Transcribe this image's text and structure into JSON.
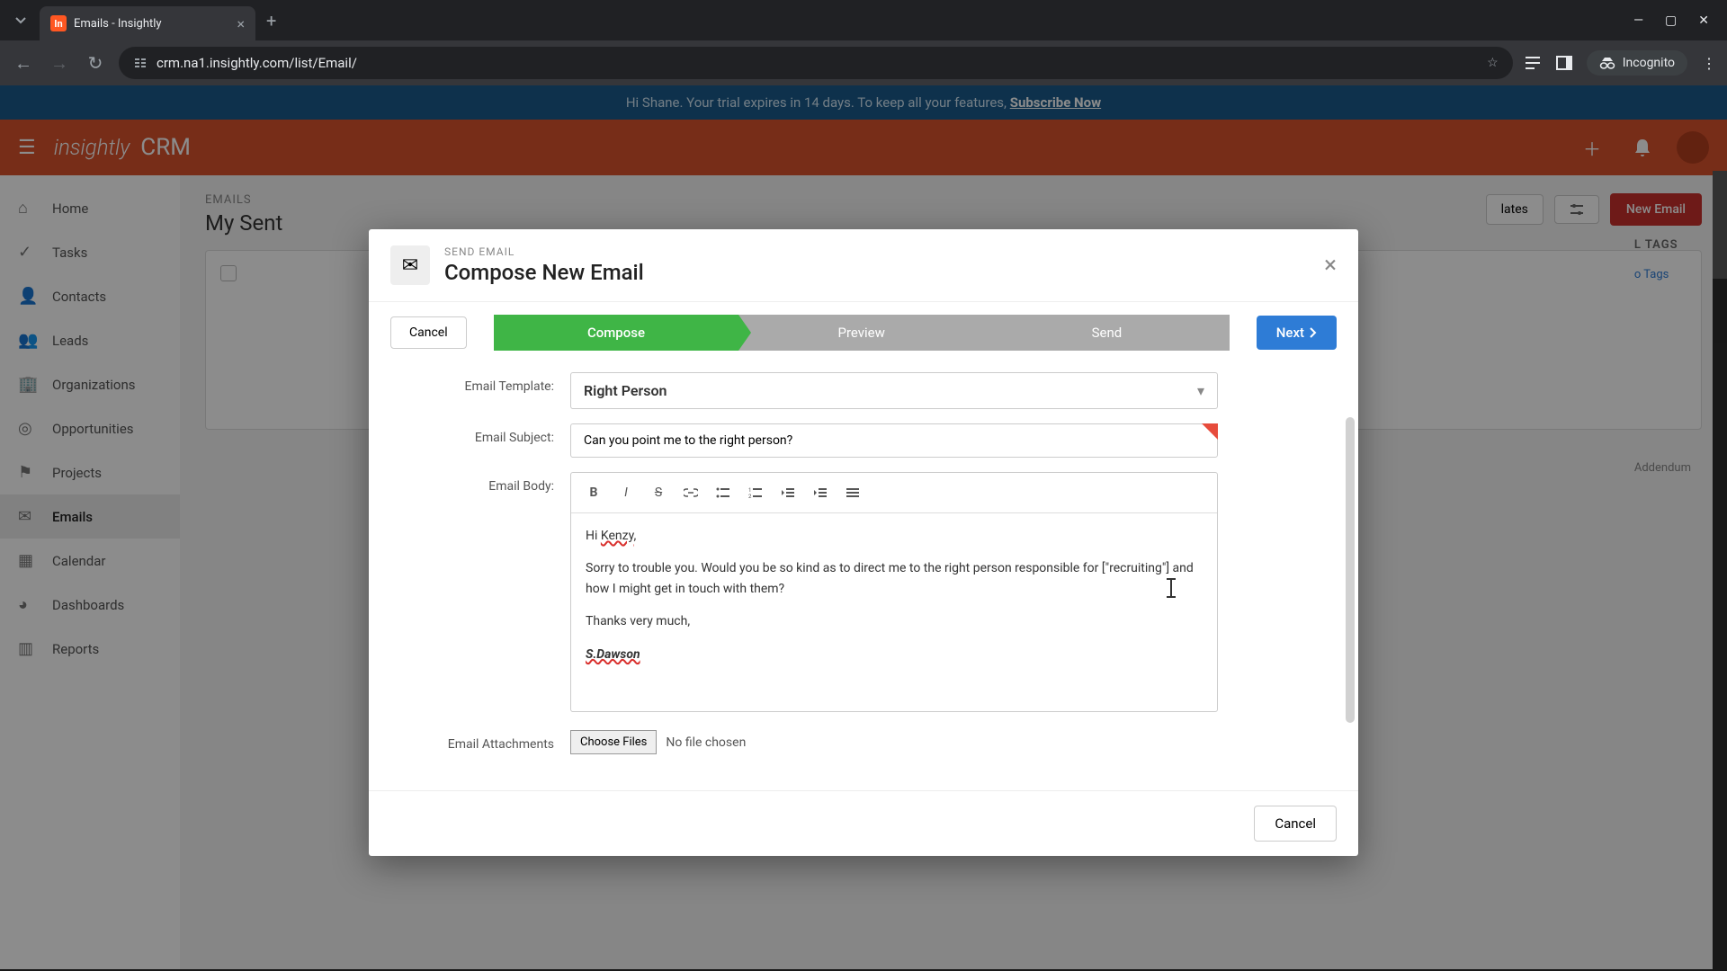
{
  "browser": {
    "tab_title": "Emails - Insightly",
    "url": "crm.na1.insightly.com/list/Email/",
    "incognito": "Incognito"
  },
  "banner": {
    "greeting": "Hi Shane. Your trial expires in 14 days. To keep all your features, ",
    "cta": "Subscribe Now"
  },
  "header": {
    "logo": "insightly",
    "product": "CRM"
  },
  "sidebar": {
    "items": [
      {
        "label": "Home"
      },
      {
        "label": "Tasks"
      },
      {
        "label": "Contacts"
      },
      {
        "label": "Leads"
      },
      {
        "label": "Organizations"
      },
      {
        "label": "Opportunities"
      },
      {
        "label": "Projects"
      },
      {
        "label": "Emails"
      },
      {
        "label": "Calendar"
      },
      {
        "label": "Dashboards"
      },
      {
        "label": "Reports"
      }
    ]
  },
  "page": {
    "kicker": "EMAILS",
    "title": "My Sent",
    "templates_btn": "lates",
    "new_email_btn": "New Email",
    "tags_header": "L TAGS",
    "no_tags": "o Tags",
    "addendum": "Addendum"
  },
  "modal": {
    "kicker": "SEND EMAIL",
    "title": "Compose New Email",
    "cancel_top": "Cancel",
    "steps": [
      "Compose",
      "Preview",
      "Send"
    ],
    "next": "Next",
    "fields": {
      "template_label": "Email Template:",
      "template_value": "Right Person",
      "subject_label": "Email Subject:",
      "subject_value": "Can you point me to the right person?",
      "body_label": "Email Body:",
      "attachments_label": "Email Attachments",
      "choose_files": "Choose Files",
      "no_file": "No file chosen"
    },
    "body": {
      "greeting_pre": "Hi ",
      "greeting_name": "Kenzy",
      "greeting_post": ",",
      "p1": "Sorry to trouble you. Would you be so kind as to direct me to the right person responsible for [\"recruiting\"] and how I might get in touch with them?",
      "p2": "Thanks very much,",
      "sig": "S.Dawson"
    },
    "cancel_bottom": "Cancel"
  }
}
